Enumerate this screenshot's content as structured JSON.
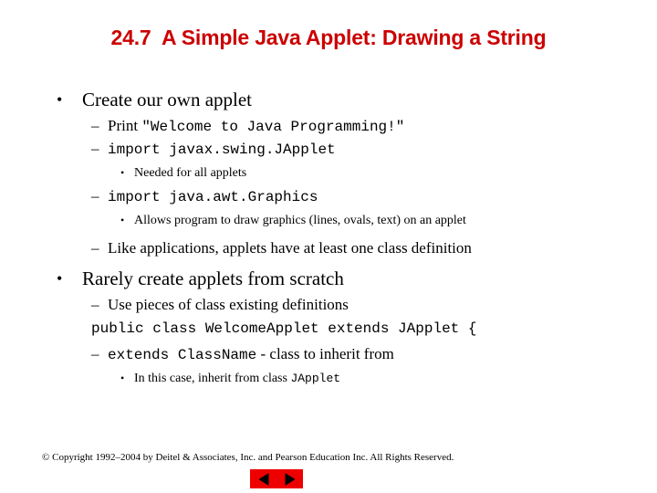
{
  "slide": {
    "title": "24.7  A Simple Java Applet: Drawing a String",
    "title_color": "#cc0000",
    "background_color": "#ffffff",
    "text_color": "#000000"
  },
  "content": {
    "b1": {
      "marker": "•",
      "text": "Create our own applet"
    },
    "b2": {
      "marker": "–",
      "prefix": "Print ",
      "code": "\"Welcome to Java Programming!\""
    },
    "b3": {
      "marker": "–",
      "code": "import javax.swing.JApplet"
    },
    "b4": {
      "marker": "•",
      "text": "Needed for all applets"
    },
    "b5": {
      "marker": "–",
      "code": "import java.awt.Graphics"
    },
    "b6": {
      "marker": "•",
      "text": "Allows program to draw graphics (lines, ovals, text) on an applet"
    },
    "b7": {
      "marker": "–",
      "text": "Like applications, applets have at least one class definition"
    },
    "b8": {
      "marker": "•",
      "text": "Rarely create applets from scratch"
    },
    "b9": {
      "marker": "–",
      "text": "Use pieces of class existing definitions"
    },
    "b10": {
      "code": "public class WelcomeApplet extends JApplet {"
    },
    "b11": {
      "marker": "–",
      "code": "extends ClassName",
      "suffix": " - class to inherit from"
    },
    "b12": {
      "marker": "•",
      "prefix": "In this case, inherit from class ",
      "code": "JApplet"
    }
  },
  "footer": {
    "copyright": "© Copyright 1992–2004 by Deitel & Associates, Inc. and Pearson Education Inc. All Rights Reserved."
  },
  "nav": {
    "prev_label": "Previous slide",
    "next_label": "Next slide",
    "button_color": "#ee0000",
    "arrow_color": "#000000"
  }
}
